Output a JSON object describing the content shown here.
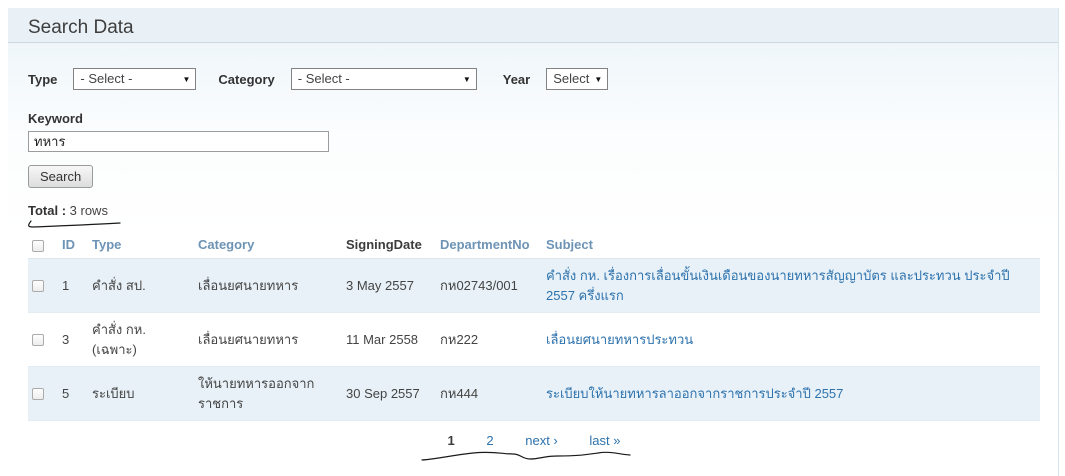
{
  "page": {
    "title": "Search Data"
  },
  "filters": {
    "type": {
      "label": "Type",
      "value": "- Select -"
    },
    "category": {
      "label": "Category",
      "value": "- Select -"
    },
    "year": {
      "label": "Year",
      "value": "Select"
    },
    "keyword": {
      "label": "Keyword",
      "value": "ทหาร"
    },
    "search_button": "Search"
  },
  "results": {
    "total_label": "Total :",
    "total_value": "3 rows"
  },
  "table": {
    "headers": [
      "ID",
      "Type",
      "Category",
      "SigningDate",
      "DepartmentNo",
      "Subject"
    ],
    "rows": [
      {
        "id": "1",
        "type": "คำสั่ง สป.",
        "category": "เลื่อนยศนายทหาร",
        "signing_date": "3 May 2557",
        "department_no": "กห02743/001",
        "subject": "คำสั่ง กห. เรื่องการเลื่อนขั้นเงินเดือนของนายทหารสัญญาบัตร และประทวน ประจำปี 2557 ครึ่งแรก"
      },
      {
        "id": "3",
        "type": "คำสั่ง กห. (เฉพาะ)",
        "category": "เลื่อนยศนายทหาร",
        "signing_date": "11 Mar 2558",
        "department_no": "กห222",
        "subject": "เลื่อนยศนายทหารประทวน"
      },
      {
        "id": "5",
        "type": "ระเบียบ",
        "category": "ให้นายทหารออกจากราชการ",
        "signing_date": "30 Sep 2557",
        "department_no": "กห444",
        "subject": "ระเบียบให้นายทหารลาออกจากราชการประจำปี 2557"
      }
    ]
  },
  "pagination": {
    "current": "1",
    "page2": "2",
    "next": "next ›",
    "last": "last »"
  },
  "icons": {
    "dropdown_arrow": "▼"
  },
  "colors": {
    "header_bg": "#e9f1f7",
    "table_header_text": "#6d93b5",
    "link": "#2d72ad",
    "row_stripe": "#e8f1f7",
    "annotation": "#1a1a1a"
  }
}
